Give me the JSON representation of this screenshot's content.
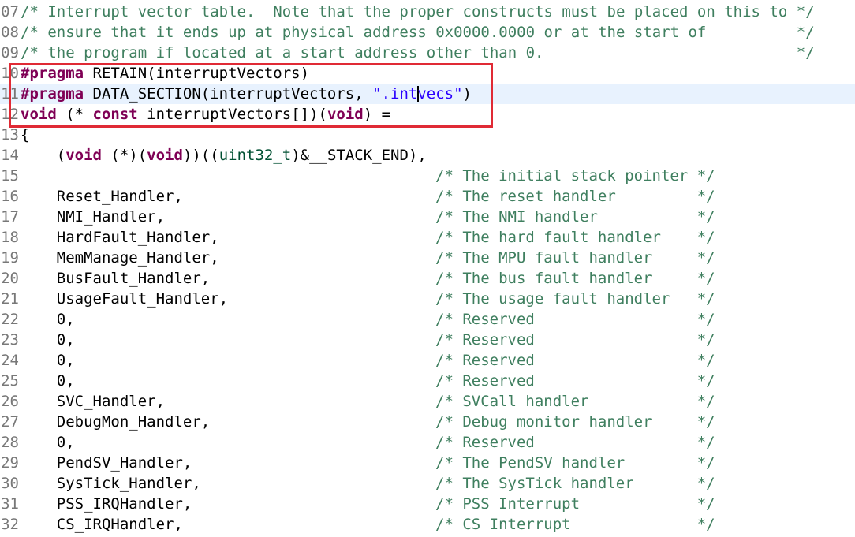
{
  "editor": {
    "highlight_color": "#e02a35",
    "lines": [
      {
        "no": "07",
        "comment": "/* Interrupt vector table.  Note that the proper constructs must be placed on this to */"
      },
      {
        "no": "08",
        "comment": "/* ensure that it ends up at physical address 0x0000.0000 or at the start of          */"
      },
      {
        "no": "09",
        "comment": "/* the program if located at a start address other than 0.                            */"
      },
      {
        "no": "10",
        "kw": "#pragma",
        "rest": " RETAIN(interruptVectors)"
      },
      {
        "no": "11",
        "kw": "#pragma",
        "rest": " DATA_SECTION(interruptVectors, ",
        "str_a": "\".int",
        "str_b": "vecs\"",
        "tail": ")"
      },
      {
        "no": "12",
        "kw1": "void",
        "mid1": " (* ",
        "kw2": "const",
        "mid2": " interruptVectors[])(",
        "kw3": "void",
        "tail": ") ="
      },
      {
        "no": "13",
        "text": "{"
      },
      {
        "no": "14",
        "pre": "    (",
        "kw1": "void",
        "mid1": " (*)(",
        "kw2": "void",
        "mid2": "))((",
        "type": "uint32_t",
        "tail": ")&__STACK_END),"
      },
      {
        "no": "15",
        "code": "",
        "comment": "/* The initial stack pointer */"
      },
      {
        "no": "16",
        "code": "    Reset_Handler,",
        "comment": "/* The reset handler         */"
      },
      {
        "no": "17",
        "code": "    NMI_Handler,",
        "comment": "/* The NMI handler           */"
      },
      {
        "no": "18",
        "code": "    HardFault_Handler,",
        "comment": "/* The hard fault handler    */"
      },
      {
        "no": "19",
        "code": "    MemManage_Handler,",
        "comment": "/* The MPU fault handler     */"
      },
      {
        "no": "20",
        "code": "    BusFault_Handler,",
        "comment": "/* The bus fault handler     */"
      },
      {
        "no": "21",
        "code": "    UsageFault_Handler,",
        "comment": "/* The usage fault handler   */"
      },
      {
        "no": "22",
        "code": "    0,",
        "comment": "/* Reserved                  */"
      },
      {
        "no": "23",
        "code": "    0,",
        "comment": "/* Reserved                  */"
      },
      {
        "no": "24",
        "code": "    0,",
        "comment": "/* Reserved                  */"
      },
      {
        "no": "25",
        "code": "    0,",
        "comment": "/* Reserved                  */"
      },
      {
        "no": "26",
        "code": "    SVC_Handler,",
        "comment": "/* SVCall handler            */"
      },
      {
        "no": "27",
        "code": "    DebugMon_Handler,",
        "comment": "/* Debug monitor handler     */"
      },
      {
        "no": "28",
        "code": "    0,",
        "comment": "/* Reserved                  */"
      },
      {
        "no": "29",
        "code": "    PendSV_Handler,",
        "comment": "/* The PendSV handler        */"
      },
      {
        "no": "30",
        "code": "    SysTick_Handler,",
        "comment": "/* The SysTick handler       */"
      },
      {
        "no": "31",
        "code": "    PSS_IRQHandler,",
        "comment": "/* PSS Interrupt             */"
      },
      {
        "no": "32",
        "code": "    CS_IRQHandler,",
        "comment": "/* CS Interrupt              */"
      }
    ]
  }
}
